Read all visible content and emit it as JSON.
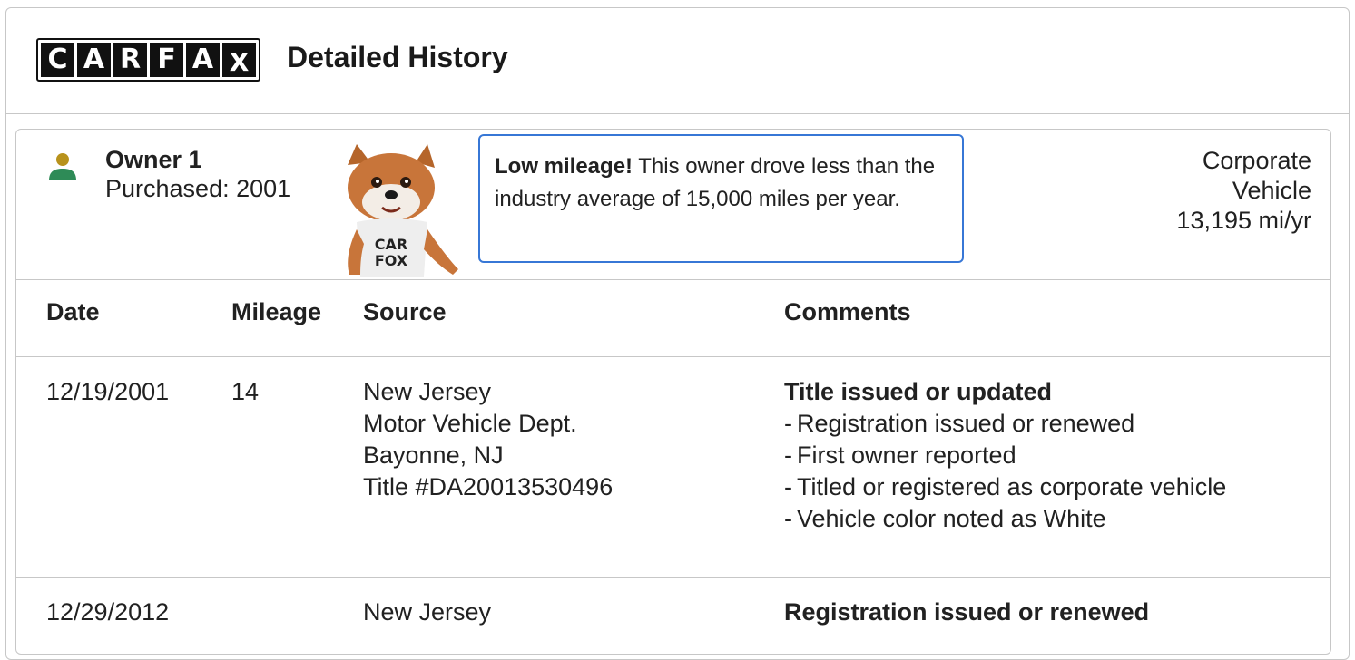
{
  "header": {
    "logo_letters": [
      "C",
      "A",
      "R",
      "F",
      "A",
      "X"
    ],
    "title": "Detailed History"
  },
  "owner": {
    "name": "Owner 1",
    "purchased": "Purchased: 2001",
    "usage_line1": "Corporate",
    "usage_line2": "Vehicle",
    "miles_per_year": "13,195 mi/yr",
    "icon": "person-icon",
    "icon_colors": {
      "head": "#b8921c",
      "body": "#2e8b57"
    }
  },
  "callout": {
    "bold": "Low mileage!",
    "text": "This owner drove less than the industry average of 15,000 miles per year."
  },
  "mascot": {
    "shirt_text_1": "CAR",
    "shirt_text_2": "FOX"
  },
  "table": {
    "columns": [
      "Date",
      "Mileage",
      "Source",
      "Comments"
    ],
    "rows": [
      {
        "date": "12/19/2001",
        "mileage": "14",
        "source": [
          "New Jersey",
          "Motor Vehicle Dept.",
          "Bayonne, NJ",
          "Title #DA20013530496"
        ],
        "comment_title": "Title issued or updated",
        "comments": [
          "Registration issued or renewed",
          "First owner reported",
          "Titled or registered as corporate vehicle",
          "Vehicle color noted as White"
        ]
      },
      {
        "date": "12/29/2012",
        "mileage": "",
        "source": [
          "New Jersey"
        ],
        "comment_title": "Registration issued or renewed",
        "comments": []
      }
    ]
  },
  "colors": {
    "accent_border": "#3777d6",
    "divider": "#c7c7c7"
  }
}
